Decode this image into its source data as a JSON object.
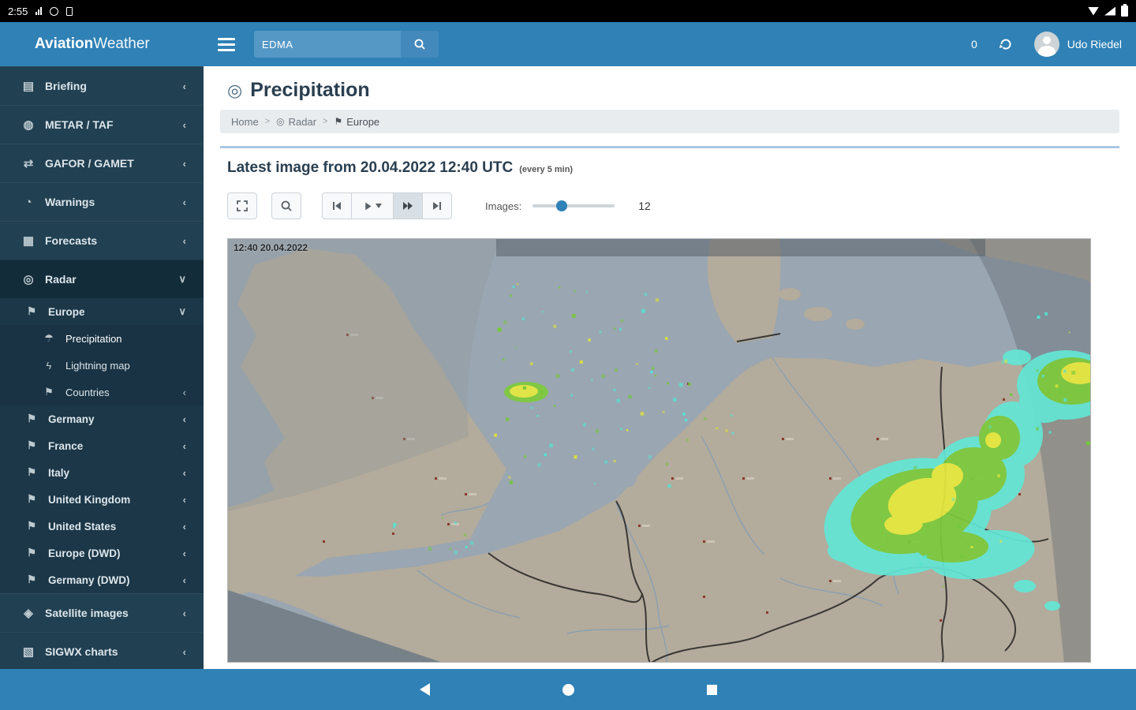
{
  "colors": {
    "accent": "#2f81b6",
    "sidebar_bg": "#214052",
    "bar_blue": "#2f81b6"
  },
  "status_bar": {
    "time": "2:55",
    "icons": [
      "chart",
      "clock",
      "storage",
      "wifi",
      "signal",
      "battery"
    ]
  },
  "top_bar": {
    "search_value": "EDMA",
    "notification_count": "0",
    "user_name": "Udo Riedel"
  },
  "brand": {
    "bold": "Aviation",
    "light": "Weather"
  },
  "sidebar": {
    "items": [
      {
        "label": "Briefing",
        "glyph": "▤",
        "chevron": "‹"
      },
      {
        "label": "METAR / TAF",
        "glyph": "◍",
        "chevron": "‹"
      },
      {
        "label": "GAFOR / GAMET",
        "glyph": "⇄",
        "chevron": "‹"
      },
      {
        "label": "Warnings",
        "glyph": "◔",
        "chevron": "‹"
      },
      {
        "label": "Forecasts",
        "glyph": "▦",
        "chevron": "‹"
      },
      {
        "label": "Radar",
        "glyph": "◎",
        "chevron": "∨"
      },
      {
        "label": "Europe",
        "glyph": "⚑",
        "chevron": "∨"
      },
      {
        "label": "Precipitation",
        "glyph": "☂",
        "chevron": ""
      },
      {
        "label": "Lightning map",
        "glyph": "ϟ",
        "chevron": ""
      },
      {
        "label": "Countries",
        "glyph": "⚑",
        "chevron": "‹"
      },
      {
        "label": "Germany",
        "glyph": "⚑",
        "chevron": "‹"
      },
      {
        "label": "France",
        "glyph": "⚑",
        "chevron": "‹"
      },
      {
        "label": "Italy",
        "glyph": "⚑",
        "chevron": "‹"
      },
      {
        "label": "United Kingdom",
        "glyph": "⚑",
        "chevron": "‹"
      },
      {
        "label": "United States",
        "glyph": "⚑",
        "chevron": "‹"
      },
      {
        "label": "Europe (DWD)",
        "glyph": "⚑",
        "chevron": "‹"
      },
      {
        "label": "Germany (DWD)",
        "glyph": "⚑",
        "chevron": "‹"
      },
      {
        "label": "Satellite images",
        "glyph": "◈",
        "chevron": "‹"
      },
      {
        "label": "SIGWX charts",
        "glyph": "▧",
        "chevron": "‹"
      }
    ]
  },
  "page": {
    "title": "Precipitation",
    "title_glyph": "◎",
    "breadcrumbs": [
      {
        "label": "Home",
        "glyph": ""
      },
      {
        "label": "Radar",
        "glyph": "◎"
      },
      {
        "label": "Europe",
        "glyph": "⚑"
      }
    ],
    "crumb_separator": ">",
    "heading": "Latest image from 20.04.2022 12:40 UTC",
    "heading_note": "(every 5 min)",
    "toolbar": {
      "images_label": "Images:",
      "images_value": "12"
    },
    "map": {
      "timestamp": "12:40 20.04.2022"
    }
  },
  "bottom_nav": {
    "icons": [
      "back",
      "home",
      "recents"
    ]
  }
}
